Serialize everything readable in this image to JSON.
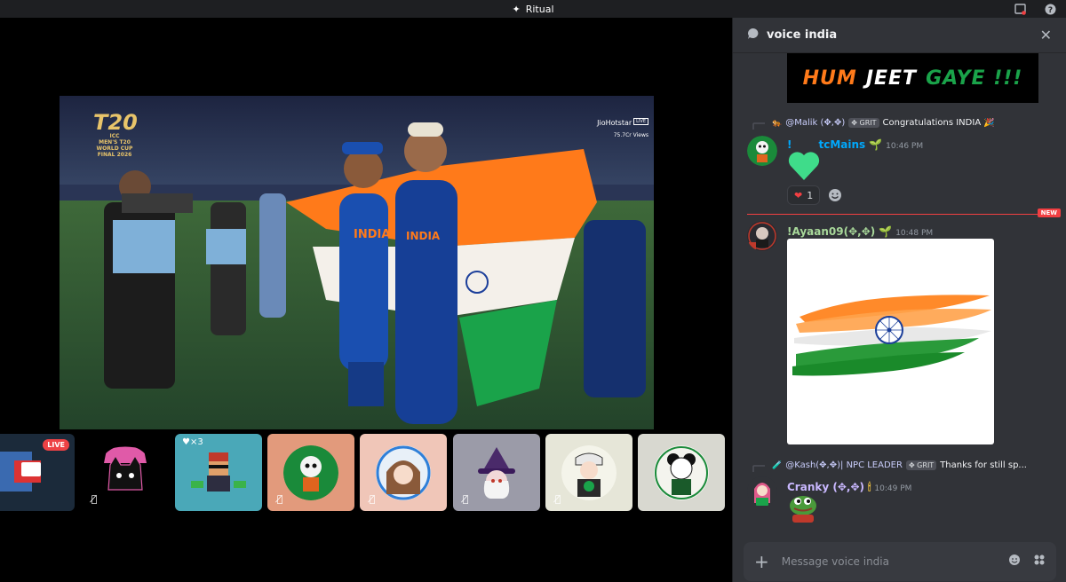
{
  "window": {
    "title": "Ritual"
  },
  "stream": {
    "logo": {
      "main": "T20",
      "line1": "ICC",
      "line2": "MEN'S T20",
      "line3": "WORLD CUP",
      "line4": "FINAL 2026"
    },
    "broadcaster": "JioHotstar",
    "live_tag": "LIVE",
    "views": "75.7Cr Views",
    "jersey_text": "INDIA"
  },
  "participants": [
    {
      "name": "screen-share",
      "live": "LIVE",
      "muted": false,
      "color": "#1b2a3a"
    },
    {
      "name": "cat-avatar",
      "muted": true,
      "color": "#000000"
    },
    {
      "name": "pixel-avatar",
      "muted": false,
      "color": "#4aa8b8",
      "badge": "3"
    },
    {
      "name": "skull-avatar",
      "muted": true,
      "color": "#e29a7c"
    },
    {
      "name": "anime-avatar",
      "muted": true,
      "color": "#f0c6b8"
    },
    {
      "name": "witch-avatar",
      "muted": true,
      "color": "#9b9ba8"
    },
    {
      "name": "samurai-avatar",
      "muted": true,
      "color": "#e6e6d8"
    },
    {
      "name": "panda-avatar",
      "muted": false,
      "color": "#d8d8d0"
    }
  ],
  "chat": {
    "channel": "voice india",
    "banner": {
      "w1": "HUM",
      "w2": "JEET",
      "w3": "GAYE !!!"
    },
    "messages": [
      {
        "reply_user": "@Malik (✥,✥)",
        "reply_tag": "✥ GRIT",
        "reply_text": "Congratulations INDIA 🎉",
        "author_prefix": "!",
        "author": "tcMains",
        "time": "10:46 PM",
        "reaction_count": "1"
      },
      {
        "author": "!Ayaan09(✥,✥)",
        "time": "10:48 PM",
        "new_label": "NEW"
      },
      {
        "reply_user": "@Kash(✥,✥)| NPC LEADER",
        "reply_tag": "✥ GRIT",
        "reply_text": "Thanks for still sp...",
        "author": "Cranky (✥,✥)",
        "time": "10:49 PM"
      }
    ],
    "composer_placeholder": "Message voice india"
  },
  "colors": {
    "accent_red": "#f23f42",
    "username_blue": "#00a8fc",
    "username_green": "#a8d89a",
    "username_purple": "#c9b8ff",
    "saffron": "#ff7a1a",
    "green": "#1aa34a"
  }
}
